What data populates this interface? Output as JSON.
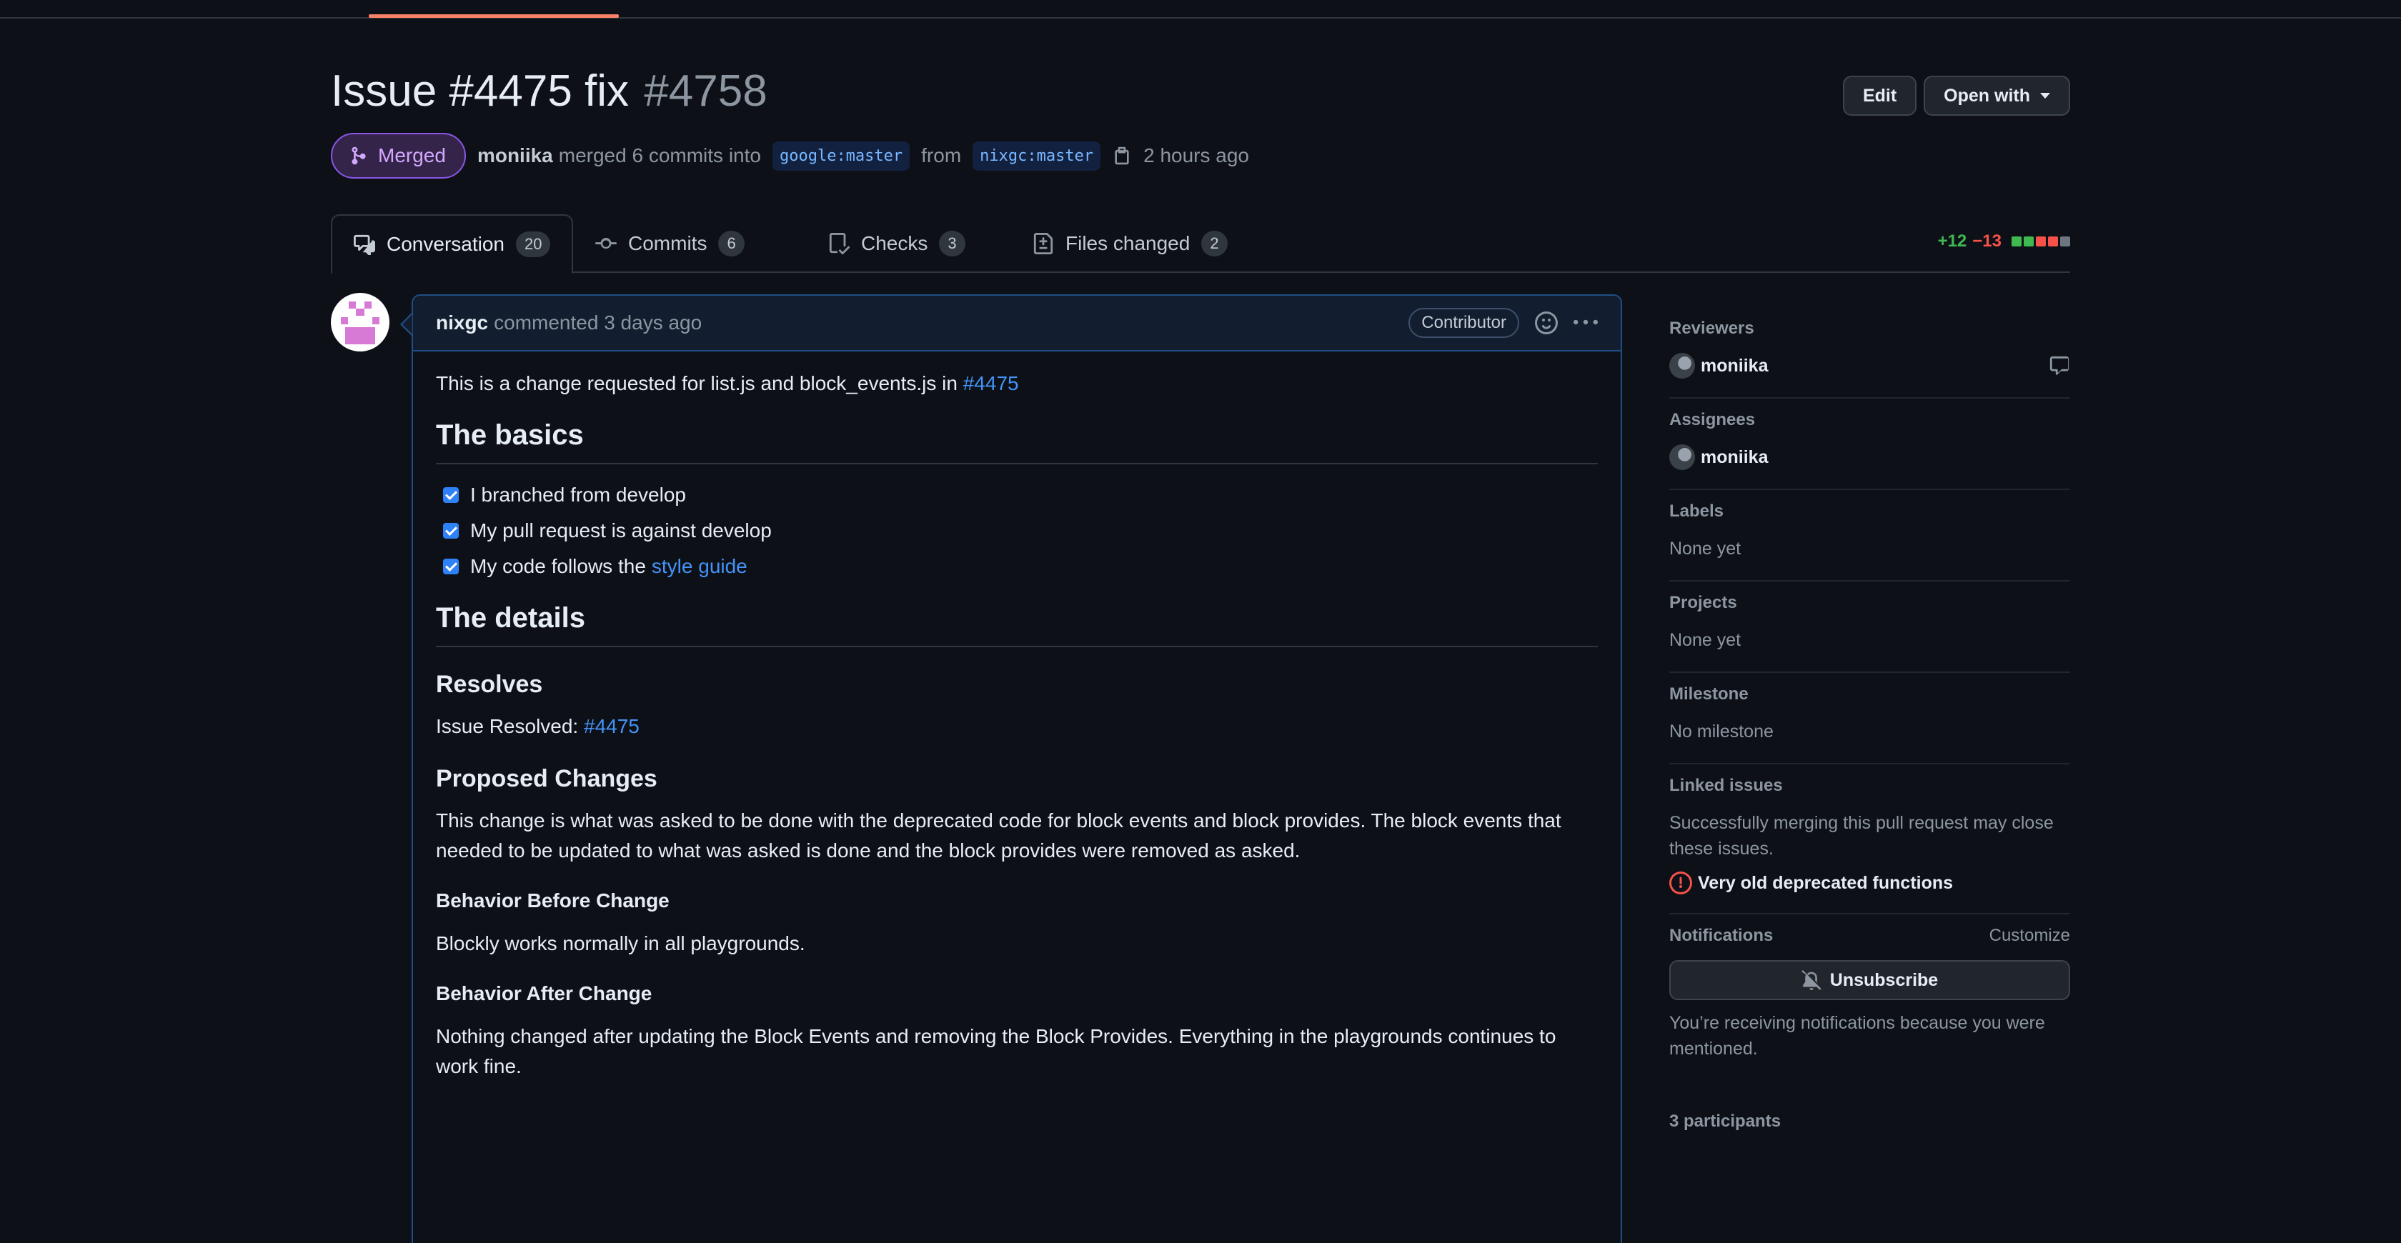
{
  "header": {
    "title": "Issue #4475 fix",
    "number": "#4758",
    "edit_label": "Edit",
    "open_with_label": "Open with"
  },
  "meta": {
    "status": "Merged",
    "author": "moniika",
    "action_text": "merged 6 commits into",
    "base_branch": "google:master",
    "from_text": "from",
    "head_branch": "nixgc:master",
    "time": "2 hours ago"
  },
  "tabs": [
    {
      "label": "Conversation",
      "count": "20",
      "icon": "comment-discussion-icon"
    },
    {
      "label": "Commits",
      "count": "6",
      "icon": "git-commit-icon"
    },
    {
      "label": "Checks",
      "count": "3",
      "icon": "checklist-icon"
    },
    {
      "label": "Files changed",
      "count": "2",
      "icon": "file-diff-icon"
    }
  ],
  "diffstat": {
    "additions": "+12",
    "deletions": "−13",
    "blocks": [
      "#3fb950",
      "#3fb950",
      "#f85149",
      "#f85149",
      "#6e7681"
    ]
  },
  "comment": {
    "author": "nixgc",
    "action": "commented 3 days ago",
    "role": "Contributor",
    "intro": "This is a change requested for list.js and block_events.js in",
    "intro_link": "#4475",
    "basics_heading": "The basics",
    "checklist": [
      {
        "text": "I branched from develop"
      },
      {
        "text": "My pull request is against develop"
      },
      {
        "text": "My code follows the",
        "link": "style guide"
      }
    ],
    "details_heading": "The details",
    "resolves_heading": "Resolves",
    "resolved_label": "Issue Resolved:",
    "resolved_link": "#4475",
    "proposed_heading": "Proposed Changes",
    "proposed_text": "This change is what was asked to be done with the deprecated code for block events and block provides. The block events that needed to be updated to what was asked is done and the block provides were removed as asked.",
    "before_heading": "Behavior Before Change",
    "before_text": "Blockly works normally in all playgrounds.",
    "after_heading": "Behavior After Change",
    "after_text": "Nothing changed after updating the Block Events and removing the Block Provides. Everything in the playgrounds continues to work fine."
  },
  "sidebar": {
    "reviewers_title": "Reviewers",
    "reviewer": "moniika",
    "assignees_title": "Assignees",
    "assignee": "moniika",
    "labels_title": "Labels",
    "labels_value": "None yet",
    "projects_title": "Projects",
    "projects_value": "None yet",
    "milestone_title": "Milestone",
    "milestone_value": "No milestone",
    "linked_title": "Linked issues",
    "linked_desc": "Successfully merging this pull request may close these issues.",
    "linked_issue": "Very old deprecated functions",
    "notifications_title": "Notifications",
    "customize": "Customize",
    "unsubscribe": "Unsubscribe",
    "notif_reason": "You’re receiving notifications because you were mentioned.",
    "participants": "3 participants"
  }
}
